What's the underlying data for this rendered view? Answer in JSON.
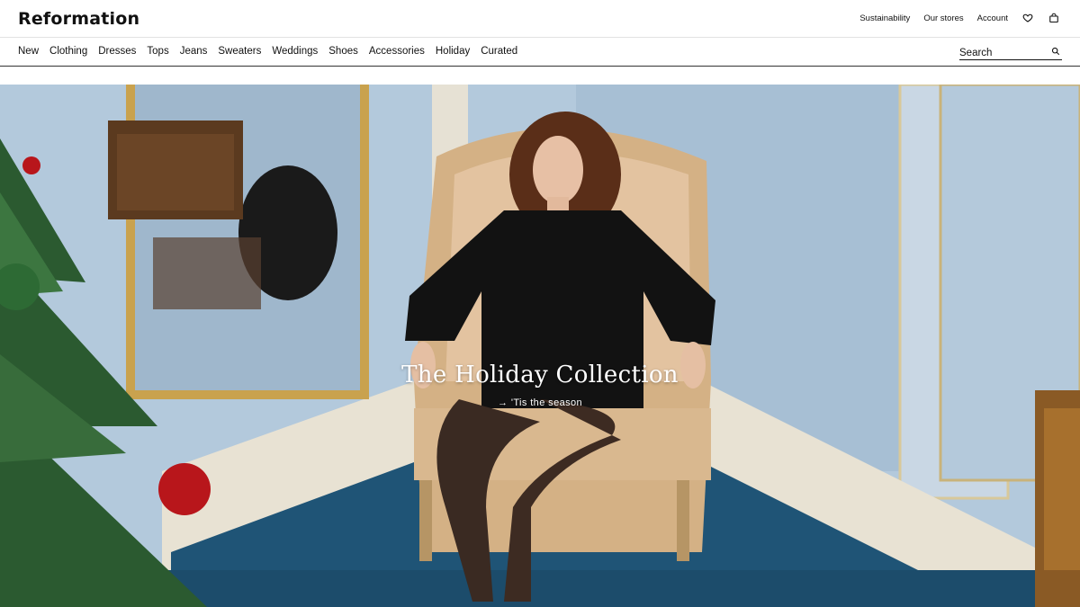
{
  "brand": {
    "logo_text": "Reformation"
  },
  "utility_nav": {
    "sustainability": "Sustainability",
    "stores": "Our stores",
    "account": "Account",
    "wishlist_icon": "heart-icon",
    "bag_icon": "shopping-bag-icon"
  },
  "main_nav": {
    "items": [
      "New",
      "Clothing",
      "Dresses",
      "Tops",
      "Jeans",
      "Sweaters",
      "Weddings",
      "Shoes",
      "Accessories",
      "Holiday",
      "Curated"
    ]
  },
  "search": {
    "placeholder": "Search",
    "icon": "search-icon"
  },
  "hero": {
    "title": "The Holiday Collection",
    "link_arrow": "→",
    "link_text": "'Tis the season"
  },
  "colors": {
    "accent_text": "#111111",
    "hero_wall": "#a9c1d6",
    "hero_carpet": "#1f5476",
    "hero_text": "#ffffff"
  }
}
